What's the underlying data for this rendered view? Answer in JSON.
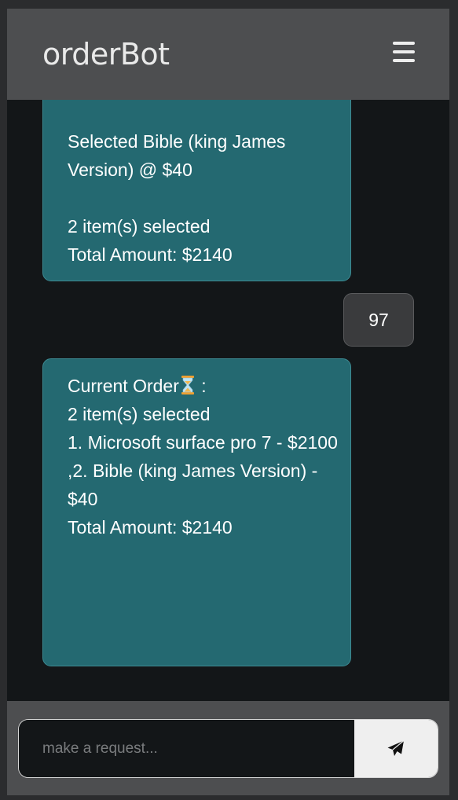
{
  "header": {
    "title": "orderBot",
    "menu_icon": "hamburger-menu-icon"
  },
  "messages": [
    {
      "sender": "bot",
      "text": "Selected Bible (king James Version) @ $40\n\n2 item(s) selected\nTotal Amount: $2140"
    },
    {
      "sender": "user",
      "text": "97"
    },
    {
      "sender": "bot",
      "text_before_icon": "Current Order",
      "icon": "hourglass-icon",
      "text_after_icon": " :",
      "text": "\n2 item(s) selected\n1. Microsoft surface pro 7 - $2100\n,2. Bible (king James Version) - $40\nTotal Amount: $2140"
    }
  ],
  "composer": {
    "placeholder": "make a request...",
    "value": "",
    "send_icon": "paper-plane-icon"
  },
  "colors": {
    "header_bg": "#4d4e50",
    "chat_bg": "#131618",
    "bot_bubble": "#246971",
    "user_bubble": "#3a3b3d",
    "send_button": "#efefef"
  }
}
